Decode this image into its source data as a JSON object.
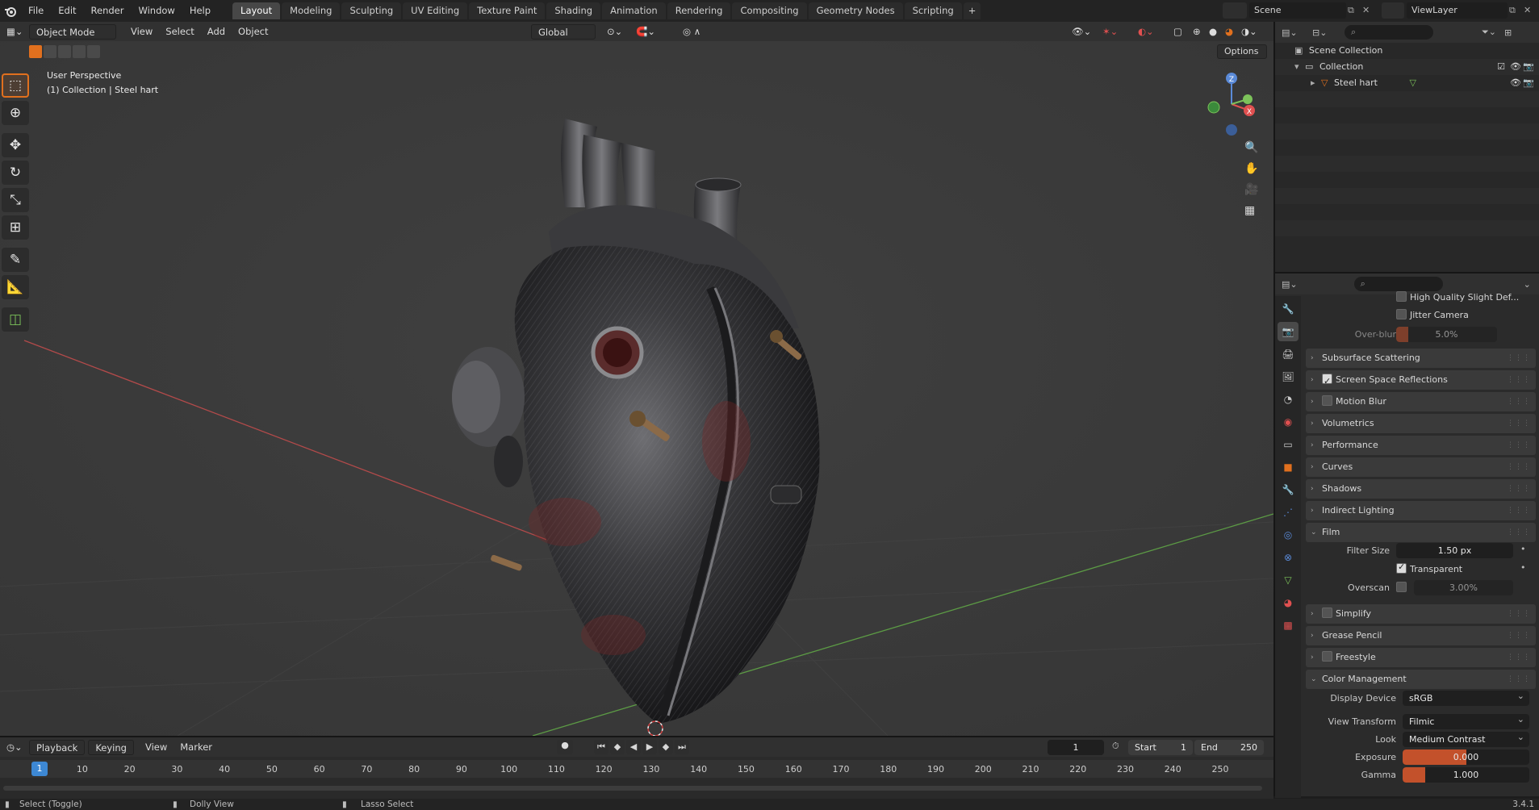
{
  "app": {
    "menus": [
      "File",
      "Edit",
      "Render",
      "Window",
      "Help"
    ],
    "workspaces": [
      "Layout",
      "Modeling",
      "Sculpting",
      "UV Editing",
      "Texture Paint",
      "Shading",
      "Animation",
      "Rendering",
      "Compositing",
      "Geometry Nodes",
      "Scripting"
    ],
    "active_workspace": "Layout",
    "scene_name": "Scene",
    "view_layer": "ViewLayer",
    "version": "3.4.1"
  },
  "viewport": {
    "mode": "Object Mode",
    "menus": [
      "View",
      "Select",
      "Add",
      "Object"
    ],
    "transform_orientation": "Global",
    "options_label": "Options",
    "perspective_label": "User Perspective",
    "collection_label": "(1) Collection | Steel hart",
    "gizmo_axes": {
      "z": "Z",
      "x": "X",
      "y": "Y"
    },
    "colors": {
      "x_axis": "#e05050",
      "y_axis": "#7cc25a",
      "z_axis": "#5a8ad8",
      "active": "#e1701e"
    }
  },
  "outliner": {
    "items": [
      {
        "label": "Scene Collection",
        "depth": 0
      },
      {
        "label": "Collection",
        "depth": 1
      },
      {
        "label": "Steel hart",
        "depth": 2
      }
    ]
  },
  "properties": {
    "high_quality_label": "High Quality Slight Def...",
    "jitter_label": "Jitter Camera",
    "overblur_label": "Over-blur",
    "overblur_value": "5.0%",
    "overblur_fraction": 0.05,
    "panels": {
      "sss": "Subsurface Scattering",
      "ssr": "Screen Space Reflections",
      "motion_blur": "Motion Blur",
      "volumetrics": "Volumetrics",
      "performance": "Performance",
      "curves": "Curves",
      "shadows": "Shadows",
      "indirect": "Indirect Lighting",
      "film": "Film",
      "simplify": "Simplify",
      "grease_pencil": "Grease Pencil",
      "freestyle": "Freestyle",
      "color_mgmt": "Color Management"
    },
    "film": {
      "filter_size_label": "Filter Size",
      "filter_size_value": "1.50 px",
      "transparent_label": "Transparent",
      "overscan_label": "Overscan",
      "overscan_value": "3.00%",
      "overscan_fraction": 0.03
    },
    "color_management": {
      "display_device_label": "Display Device",
      "display_device": "sRGB",
      "view_transform_label": "View Transform",
      "view_transform": "Filmic",
      "look_label": "Look",
      "look": "Medium Contrast",
      "exposure_label": "Exposure",
      "exposure": "0.000",
      "gamma_label": "Gamma",
      "gamma": "1.000"
    }
  },
  "timeline": {
    "menus": [
      "Playback",
      "Keying",
      "View",
      "Marker"
    ],
    "current_frame": "1",
    "start_label": "Start",
    "start": "1",
    "end_label": "End",
    "end": "250",
    "ticks": [
      "1",
      "10",
      "20",
      "30",
      "40",
      "50",
      "60",
      "70",
      "80",
      "90",
      "100",
      "110",
      "120",
      "130",
      "140",
      "150",
      "160",
      "170",
      "180",
      "190",
      "200",
      "210",
      "220",
      "230",
      "240",
      "250"
    ]
  },
  "statusbar": {
    "left": "Select (Toggle)",
    "middle": "Dolly View",
    "right": "Lasso Select"
  }
}
